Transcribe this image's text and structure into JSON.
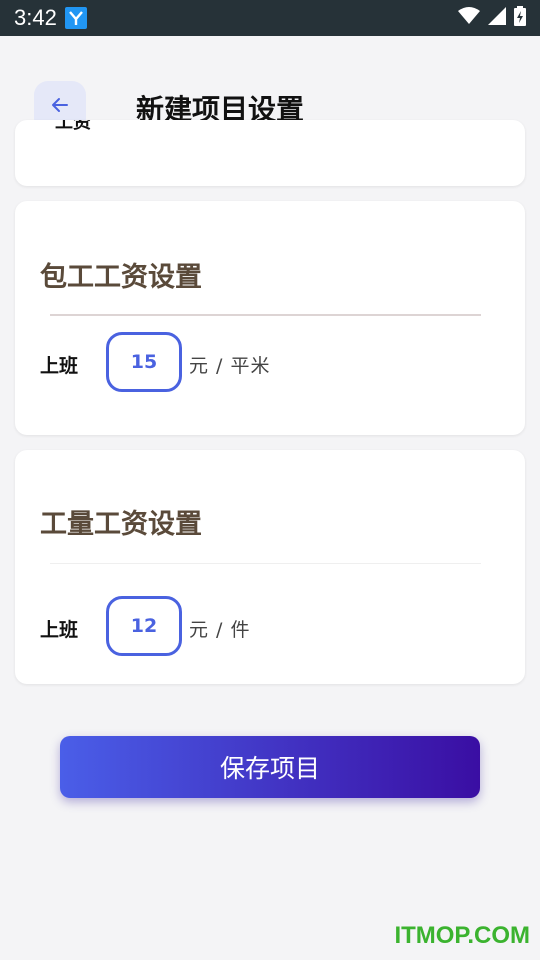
{
  "status_bar": {
    "time": "3:42",
    "app_icon": "y-app-icon",
    "wifi_icon": "wifi-icon",
    "signal_icon": "signal-icon",
    "battery_icon": "battery-icon"
  },
  "header": {
    "back_icon": "arrow-left-icon",
    "title": "新建项目设置"
  },
  "partial_card": {
    "label": "工资"
  },
  "contract_section": {
    "title": "包工工资设置",
    "row_label": "上班",
    "value": "15",
    "unit": "元 / 平米"
  },
  "piece_section": {
    "title": "工量工资设置",
    "row_label": "上班",
    "value": "12",
    "unit": "元 / 件"
  },
  "save_button": {
    "label": "保存项目"
  },
  "watermark": "ITMOP.COM",
  "colors": {
    "accent": "#4a62e0",
    "title_brown": "#5a4a3a",
    "button_gradient_start": "#4a5ee8",
    "button_gradient_end": "#3a0ea3",
    "watermark": "#3bb32f"
  }
}
